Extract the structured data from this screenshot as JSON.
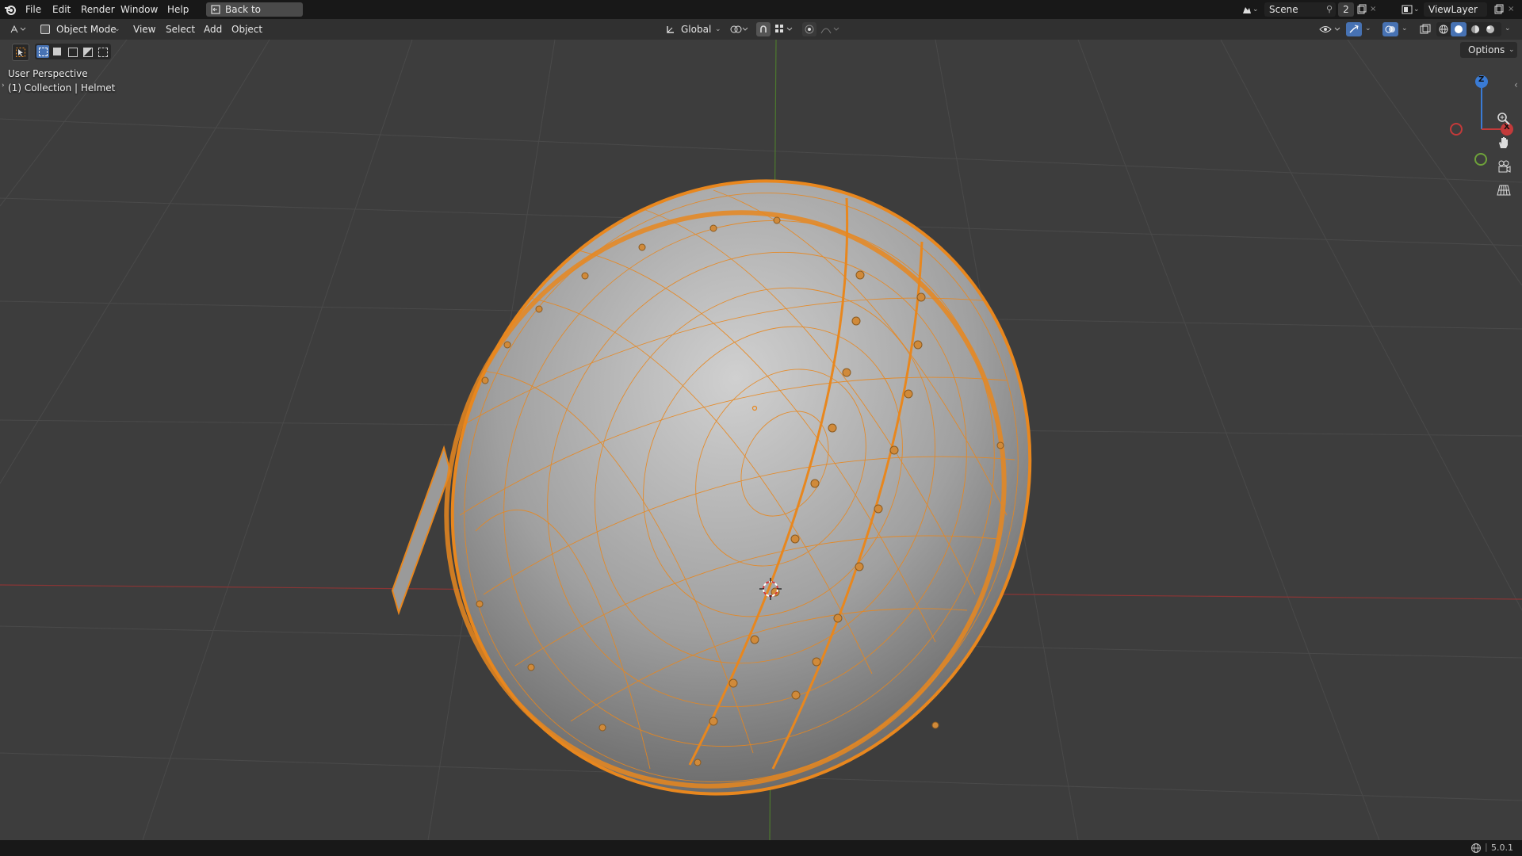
{
  "menu": {
    "items": [
      "File",
      "Edit",
      "Render",
      "Window",
      "Help"
    ],
    "back_button": "Back to Previous"
  },
  "scene": {
    "label": "Scene",
    "count": "2"
  },
  "view_layer": {
    "label": "ViewLayer"
  },
  "header": {
    "mode": "Object Mode",
    "menus": [
      "View",
      "Select",
      "Add",
      "Object"
    ],
    "orientation": "Global",
    "options": "Options"
  },
  "viewport": {
    "perspective": "User Perspective",
    "collection": "(1) Collection | Helmet",
    "gizmo": {
      "z": "Z",
      "x": "X"
    }
  },
  "status": {
    "version": "5.0.1"
  },
  "colors": {
    "selection": "#e8871e",
    "axis_x": "#c33a3a",
    "axis_y": "#6ea23a",
    "axis_z": "#3a7bd5",
    "active_button": "#4772b3"
  },
  "icons": [
    "blender-logo-icon",
    "back-icon",
    "editor-type-icon",
    "object-mode-icon",
    "transform-orientation-icon",
    "pivot-icon",
    "snap-icon",
    "proportional-icon",
    "visibility-icon",
    "gizmo-icon",
    "overlay-icon",
    "xray-icon",
    "wireframe-shading-icon",
    "solid-shading-icon",
    "material-shading-icon",
    "rendered-shading-icon",
    "zoom-icon",
    "pan-hand-icon",
    "camera-icon",
    "grid-icon",
    "select-tool-icon",
    "network-icon"
  ]
}
